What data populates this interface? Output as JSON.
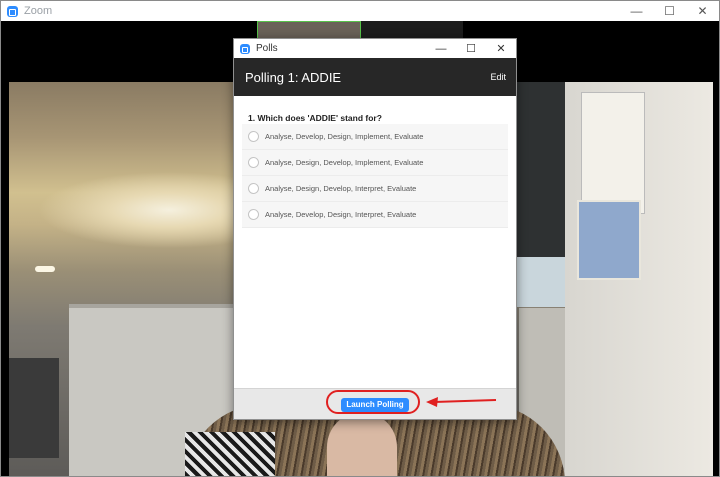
{
  "zoom_window": {
    "title": "Zoom",
    "controls": {
      "minimize": "—",
      "maximize": "☐",
      "close": "✕"
    }
  },
  "polls_dialog": {
    "title": "Polls",
    "controls": {
      "minimize": "—",
      "maximize": "☐",
      "close": "✕"
    },
    "poll_name": "Polling 1: ADDIE",
    "edit_label": "Edit",
    "question": "1. Which does 'ADDIE' stand for?",
    "options": [
      "Analyse, Develop, Design, Implement, Evaluate",
      "Analyse, Design, Develop, Implement, Evaluate",
      "Analyse, Design, Develop, Interpret, Evaluate",
      "Analyse, Develop, Design, Interpret, Evaluate"
    ],
    "launch_label": "Launch Polling"
  },
  "colors": {
    "accent": "#2d8cff",
    "header_bg": "#272727",
    "annotation": "#e02020"
  },
  "icons": [
    "zoom-logo-icon",
    "minimize-icon",
    "maximize-icon",
    "close-icon",
    "radio-icon",
    "annotation-arrow-icon"
  ]
}
